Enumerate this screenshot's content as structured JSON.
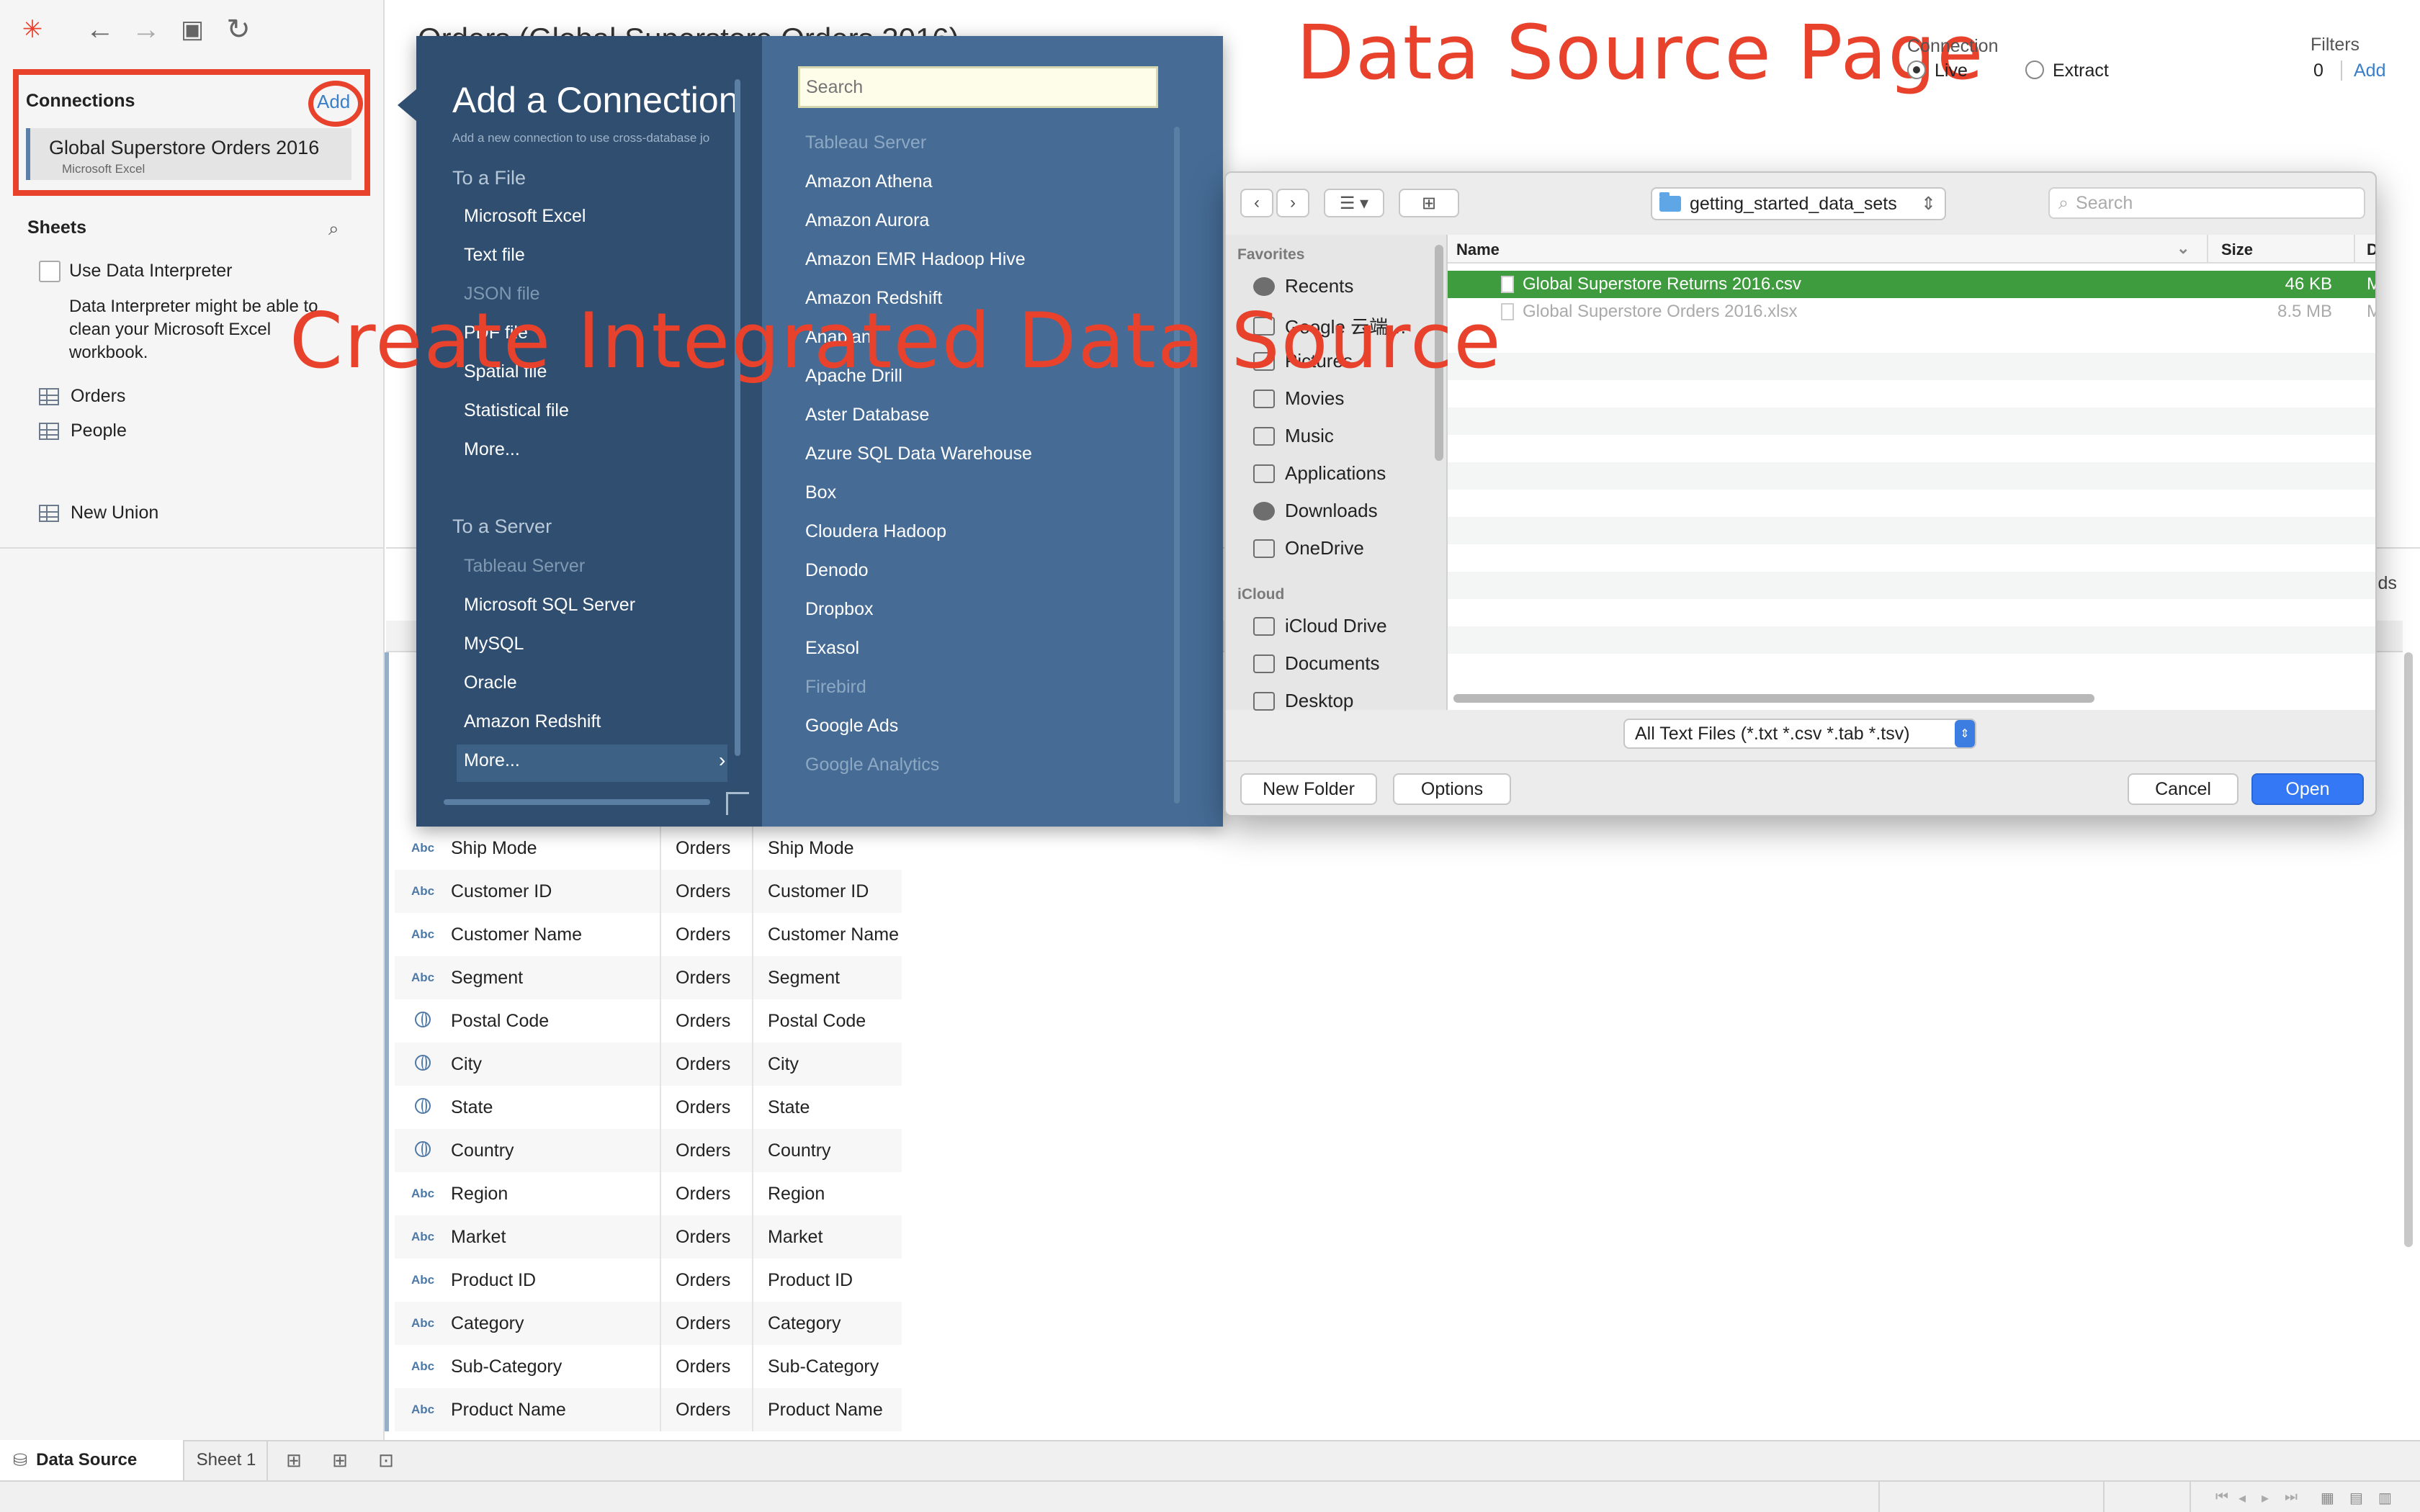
{
  "toolbar": {
    "icons": [
      "tableau-logo-icon",
      "back-arrow-icon",
      "forward-arrow-icon",
      "save-icon",
      "refresh-icon"
    ],
    "datasource_title": "Orders (Global Superstore Orders 2016)"
  },
  "annotations": {
    "data_source_page": "Data Source Page",
    "create_integrated": "Create Integrated Data Source",
    "color": "#e8412c"
  },
  "sidebar": {
    "connections_header": "Connections",
    "add_label": "Add",
    "connection": {
      "name": "Global Superstore Orders 2016",
      "type": "Microsoft Excel"
    },
    "sheets_header": "Sheets",
    "data_interpreter_label": "Use Data Interpreter",
    "data_interpreter_desc": "Data Interpreter might be able to clean your Microsoft Excel workbook.",
    "sheets": [
      "Orders",
      "People"
    ],
    "new_union": "New Union"
  },
  "connection_mode": {
    "label": "Connection",
    "live": "Live",
    "extract": "Extract",
    "selected": "Live"
  },
  "filters": {
    "label": "Filters",
    "count": "0",
    "add": "Add"
  },
  "main": {
    "fields_tail": "elds",
    "rows": [
      {
        "type": "Abc",
        "name": "Ship Mode",
        "table": "Orders",
        "remote": "Ship Mode"
      },
      {
        "type": "Abc",
        "name": "Customer ID",
        "table": "Orders",
        "remote": "Customer ID"
      },
      {
        "type": "Abc",
        "name": "Customer Name",
        "table": "Orders",
        "remote": "Customer Name"
      },
      {
        "type": "Abc",
        "name": "Segment",
        "table": "Orders",
        "remote": "Segment"
      },
      {
        "type": "geo",
        "name": "Postal Code",
        "table": "Orders",
        "remote": "Postal Code"
      },
      {
        "type": "geo",
        "name": "City",
        "table": "Orders",
        "remote": "City"
      },
      {
        "type": "geo",
        "name": "State",
        "table": "Orders",
        "remote": "State"
      },
      {
        "type": "geo",
        "name": "Country",
        "table": "Orders",
        "remote": "Country"
      },
      {
        "type": "Abc",
        "name": "Region",
        "table": "Orders",
        "remote": "Region"
      },
      {
        "type": "Abc",
        "name": "Market",
        "table": "Orders",
        "remote": "Market"
      },
      {
        "type": "Abc",
        "name": "Product ID",
        "table": "Orders",
        "remote": "Product ID"
      },
      {
        "type": "Abc",
        "name": "Category",
        "table": "Orders",
        "remote": "Category"
      },
      {
        "type": "Abc",
        "name": "Sub-Category",
        "table": "Orders",
        "remote": "Sub-Category"
      },
      {
        "type": "Abc",
        "name": "Product Name",
        "table": "Orders",
        "remote": "Product Name"
      }
    ]
  },
  "add_connection": {
    "title": "Add a Connection",
    "subtitle": "Add a new connection to use cross-database jo",
    "to_a_file": "To a File",
    "file_items": [
      {
        "label": "Microsoft Excel",
        "dim": false
      },
      {
        "label": "Text file",
        "dim": false
      },
      {
        "label": "JSON file",
        "dim": true
      },
      {
        "label": "PDF file",
        "dim": false
      },
      {
        "label": "Spatial file",
        "dim": false
      },
      {
        "label": "Statistical file",
        "dim": false
      },
      {
        "label": "More...",
        "dim": false
      }
    ],
    "to_a_server": "To a Server",
    "server_items": [
      {
        "label": "Tableau Server",
        "dim": true
      },
      {
        "label": "Microsoft SQL Server",
        "dim": false
      },
      {
        "label": "MySQL",
        "dim": false
      },
      {
        "label": "Oracle",
        "dim": false
      },
      {
        "label": "Amazon Redshift",
        "dim": false
      },
      {
        "label": "More...",
        "dim": false
      }
    ],
    "search_placeholder": "Search",
    "connectors": [
      {
        "label": "Tableau Server",
        "dim": true
      },
      {
        "label": "Amazon Athena",
        "dim": false
      },
      {
        "label": "Amazon Aurora",
        "dim": false
      },
      {
        "label": "Amazon EMR Hadoop Hive",
        "dim": false
      },
      {
        "label": "Amazon Redshift",
        "dim": false
      },
      {
        "label": "Anaplan",
        "dim": false
      },
      {
        "label": "Apache Drill",
        "dim": false
      },
      {
        "label": "Aster Database",
        "dim": false
      },
      {
        "label": "Azure SQL Data Warehouse",
        "dim": false
      },
      {
        "label": "Box",
        "dim": false
      },
      {
        "label": "Cloudera Hadoop",
        "dim": false
      },
      {
        "label": "Denodo",
        "dim": false
      },
      {
        "label": "Dropbox",
        "dim": false
      },
      {
        "label": "Exasol",
        "dim": false
      },
      {
        "label": "Firebird",
        "dim": true
      },
      {
        "label": "Google Ads",
        "dim": false
      },
      {
        "label": "Google Analytics",
        "dim": true
      }
    ]
  },
  "file_dialog": {
    "folder": "getting_started_data_sets",
    "search_placeholder": "Search",
    "favorites_header": "Favorites",
    "favorites": [
      {
        "label": "Recents",
        "icon": "clock-icon"
      },
      {
        "label": "Google 云端…",
        "icon": "folder-icon"
      },
      {
        "label": "Pictures",
        "icon": "camera-icon"
      },
      {
        "label": "Movies",
        "icon": "film-icon"
      },
      {
        "label": "Music",
        "icon": "music-note-icon"
      },
      {
        "label": "Applications",
        "icon": "applications-icon"
      },
      {
        "label": "Downloads",
        "icon": "download-icon"
      },
      {
        "label": "OneDrive",
        "icon": "folder-icon"
      }
    ],
    "icloud_header": "iCloud",
    "icloud": [
      {
        "label": "iCloud Drive",
        "icon": "cloud-icon"
      },
      {
        "label": "Documents",
        "icon": "documents-icon"
      },
      {
        "label": "Desktop",
        "icon": "desktop-icon"
      }
    ],
    "columns": {
      "name": "Name",
      "size": "Size",
      "date": "D"
    },
    "files": [
      {
        "name": "Global Superstore Returns 2016.csv",
        "size": "46 KB",
        "date": "M",
        "selected": true
      },
      {
        "name": "Global Superstore Orders 2016.xlsx",
        "size": "8.5 MB",
        "date": "M",
        "selected": false
      }
    ],
    "filter": "All Text Files (*.txt *.csv *.tab *.tsv)",
    "new_folder": "New Folder",
    "options": "Options",
    "cancel": "Cancel",
    "open": "Open"
  },
  "tabs": {
    "data_source": "Data Source",
    "sheet1": "Sheet 1"
  }
}
